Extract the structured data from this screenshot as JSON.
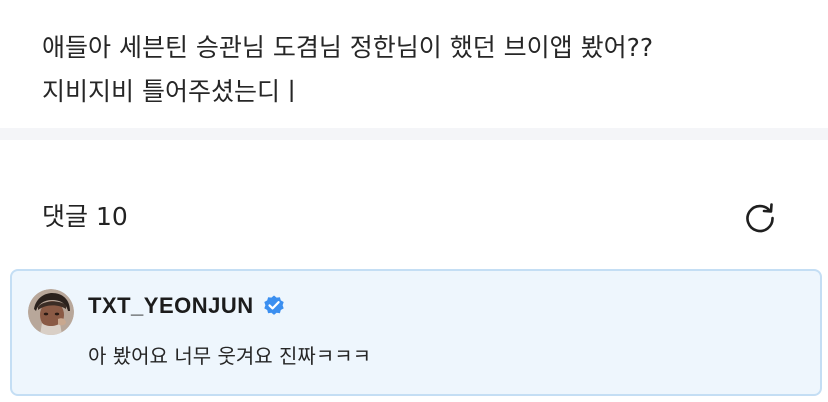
{
  "post": {
    "text": "애들아 세븐틴 승관님 도겸님 정한님이 했던 브이앱 봤어??\n지비지비 틀어주셨는디ㅣ"
  },
  "comments": {
    "title": "댓글 10"
  },
  "comment": {
    "username": "TXT_YEONJUN",
    "text": "아 봤어요 너무 웃겨요 진짜ㅋㅋㅋ",
    "verified_color": "#3b8ff0"
  },
  "icons": {
    "refresh": "refresh-icon",
    "verified": "verified-badge-icon",
    "avatar": "avatar"
  },
  "colors": {
    "card_background": "#eef6fd",
    "card_border": "#c4def4",
    "divider": "#f4f5f8"
  }
}
